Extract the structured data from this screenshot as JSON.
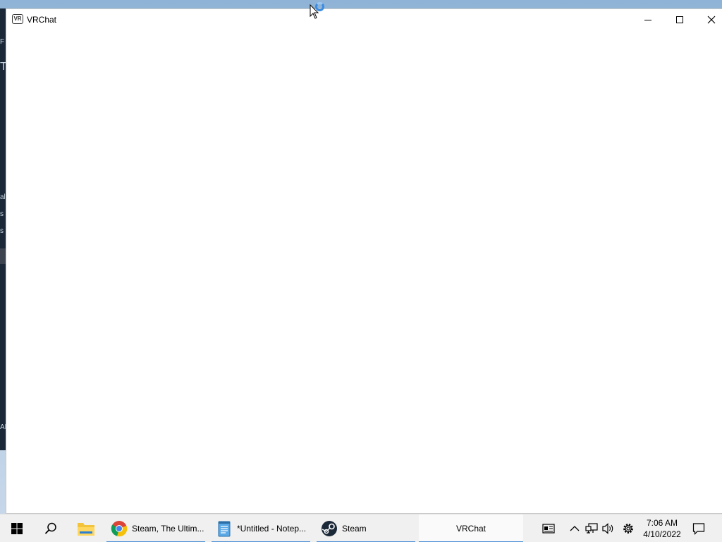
{
  "window": {
    "title": "VRChat",
    "icon_text": "VR",
    "controls": [
      "minimize-icon",
      "maximize-icon",
      "close-icon"
    ]
  },
  "background_app": {
    "letters": [
      "F",
      "T",
      "al",
      "s",
      "s",
      "AM"
    ]
  },
  "taskbar": {
    "start_icon": "windows-start-icon",
    "search_icon": "search-icon",
    "pinned": [
      {
        "name": "file-explorer-icon"
      }
    ],
    "apps": [
      {
        "label": "Steam, The Ultim...",
        "icon": "chrome-icon"
      },
      {
        "label": "*Untitled - Notep...",
        "icon": "notepad-icon"
      },
      {
        "label": "Steam",
        "icon": "steam-icon"
      },
      {
        "label": "VRChat",
        "icon": ""
      }
    ],
    "tray": [
      "news-icon",
      "chevron-up-icon",
      "network-icon",
      "volume-icon",
      "settings-gear-icon"
    ],
    "clock": {
      "time": "7:06 AM",
      "date": "4/10/2022"
    },
    "notification_icon": "action-center-icon"
  },
  "colors": {
    "taskbar_bg": "#f0f0f0",
    "taskbar_accent": "#4c8fd6",
    "steam_bg": "#1b2838"
  }
}
